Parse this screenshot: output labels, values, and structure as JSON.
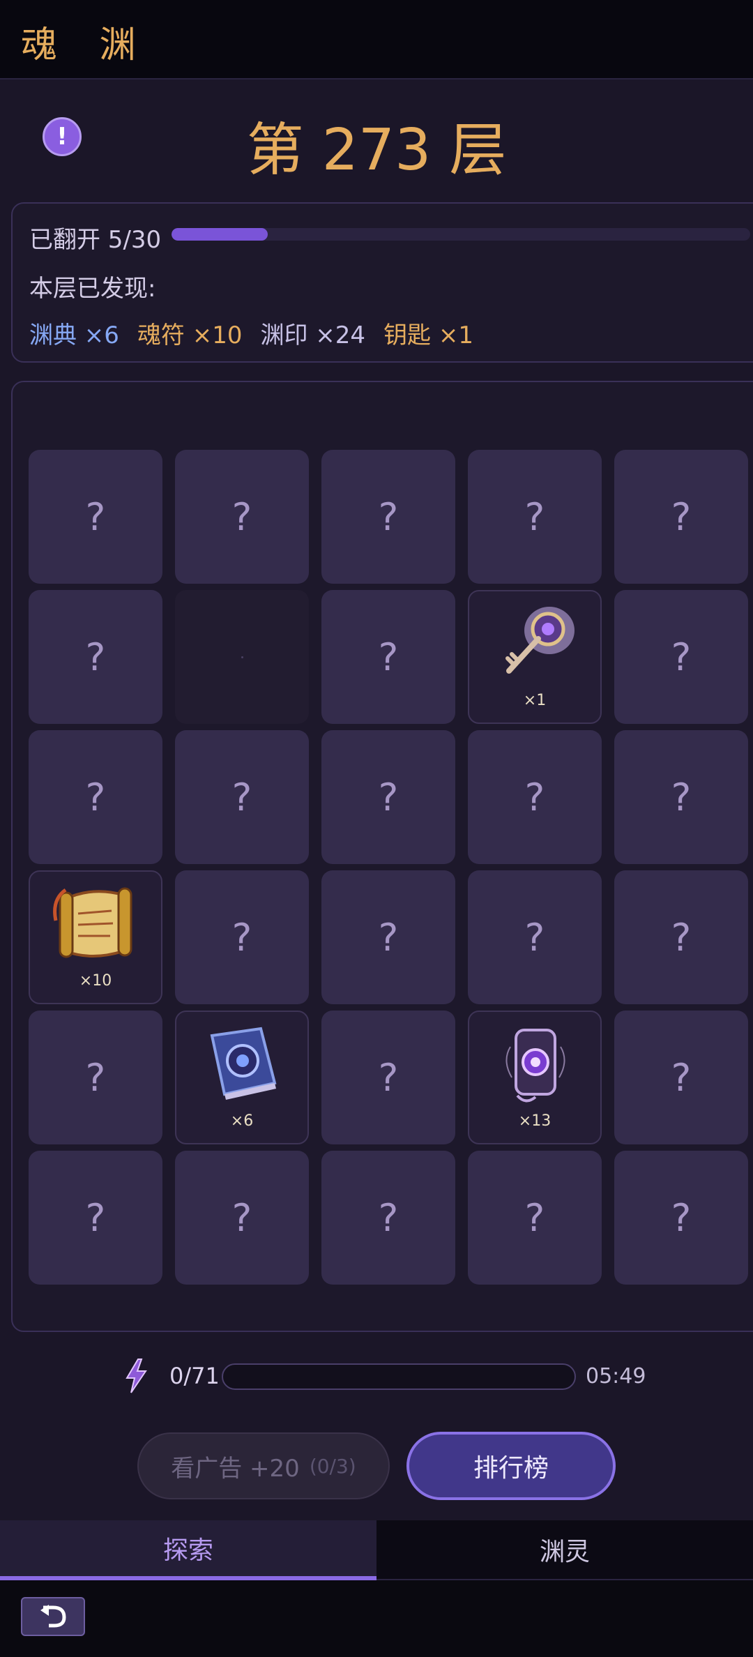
{
  "header": {
    "title": "魂 渊"
  },
  "floor": {
    "title": "第 273 层",
    "info_icon": "exclamation-icon",
    "info_glyph": "!"
  },
  "progress": {
    "opened_label": "已翻开 5/30",
    "opened_fraction": 0.1667,
    "found_label": "本层已发现:",
    "items": [
      {
        "text": "渊典 ×6",
        "color": "#86a8f4"
      },
      {
        "text": "魂符 ×10",
        "color": "#e6ad5e"
      },
      {
        "text": "渊印 ×24",
        "color": "#c7c1e6"
      },
      {
        "text": "钥匙 ×1",
        "color": "#e6ad5e"
      }
    ]
  },
  "grid": {
    "hidden_glyph": "?",
    "tiles": [
      {
        "state": "hidden"
      },
      {
        "state": "hidden"
      },
      {
        "state": "hidden"
      },
      {
        "state": "hidden"
      },
      {
        "state": "hidden"
      },
      {
        "state": "hidden"
      },
      {
        "state": "empty"
      },
      {
        "state": "hidden"
      },
      {
        "state": "revealed",
        "item": "key-icon",
        "count": "×1"
      },
      {
        "state": "hidden"
      },
      {
        "state": "hidden"
      },
      {
        "state": "hidden"
      },
      {
        "state": "hidden"
      },
      {
        "state": "hidden"
      },
      {
        "state": "hidden"
      },
      {
        "state": "revealed",
        "item": "scroll-icon",
        "count": "×10"
      },
      {
        "state": "hidden"
      },
      {
        "state": "hidden"
      },
      {
        "state": "hidden"
      },
      {
        "state": "hidden"
      },
      {
        "state": "hidden"
      },
      {
        "state": "revealed",
        "item": "book-icon",
        "count": "×6"
      },
      {
        "state": "hidden"
      },
      {
        "state": "revealed",
        "item": "seal-card-icon",
        "count": "×13"
      },
      {
        "state": "hidden"
      },
      {
        "state": "hidden"
      },
      {
        "state": "hidden"
      },
      {
        "state": "hidden"
      },
      {
        "state": "hidden"
      },
      {
        "state": "hidden"
      }
    ]
  },
  "energy": {
    "icon": "lightning-icon",
    "text": "0/71",
    "fraction": 0.0,
    "timer": "05:49"
  },
  "buttons": {
    "ad_label": "看广告 +20",
    "ad_count": "(0/3)",
    "rank_label": "排行榜"
  },
  "tabs": [
    {
      "label": "探索",
      "active": true
    },
    {
      "label": "渊灵",
      "active": false
    }
  ],
  "footer": {
    "back_icon": "back-arrow-icon"
  },
  "colors": {
    "accent": "#7a54d8",
    "gold": "#e6ad5e",
    "tile": "#342c4c"
  }
}
